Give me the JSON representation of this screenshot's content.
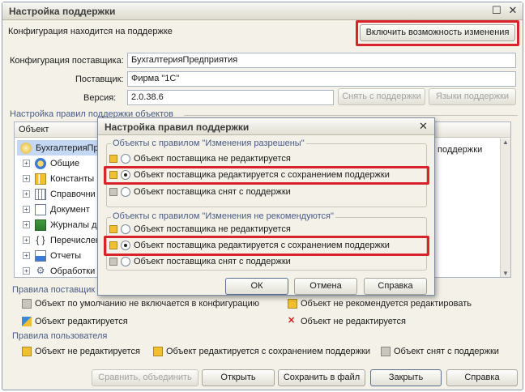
{
  "window": {
    "title": "Настройка поддержки"
  },
  "status": {
    "text": "Конфигурация находится на поддержке",
    "enable_button": "Включить возможность изменения"
  },
  "fields": {
    "config_label": "Конфигурация поставщика:",
    "config_value": "БухгалтерияПредприятия",
    "vendor_label": "Поставщик:",
    "vendor_value": "Фирма \"1С\"",
    "version_label": "Версия:",
    "version_value": "2.0.38.6",
    "remove_support_button": "Снять с поддержки",
    "support_languages_button": "Языки поддержки"
  },
  "objects_group": {
    "title": "Настройка правил поддержки объектов",
    "column": "Объект",
    "right_col_text": "поддержки"
  },
  "tree": [
    {
      "label": "БухгалтерияПр",
      "icon": "config-icon"
    },
    {
      "label": "Общие",
      "icon": "common-icon"
    },
    {
      "label": "Константы",
      "icon": "constants-icon"
    },
    {
      "label": "Справочни",
      "icon": "catalogs-icon"
    },
    {
      "label": "Документ",
      "icon": "documents-icon"
    },
    {
      "label": "Журналы д",
      "icon": "journals-icon"
    },
    {
      "label": "Перечислен",
      "icon": "enums-icon"
    },
    {
      "label": "Отчеты",
      "icon": "reports-icon"
    },
    {
      "label": "Обработки",
      "icon": "processing-icon"
    }
  ],
  "vendor_rules": {
    "title": "Правила поставщик",
    "items": [
      "Объект по умолчанию не включается в конфигурацию",
      "Объект редактируется",
      "Объект не рекомендуется редактировать",
      "Объект не редактируется"
    ]
  },
  "user_rules": {
    "title": "Правила пользователя",
    "items": [
      "Объект не редактируется",
      "Объект редактируется с сохранением поддержки",
      "Объект снят с поддержки"
    ]
  },
  "bottom_buttons": [
    "Сравнить, объединить",
    "Открыть",
    "Сохранить в файл",
    "Закрыть",
    "Справка"
  ],
  "dialog": {
    "title": "Настройка правил поддержки",
    "group1": {
      "title": "Объекты с правилом \"Изменения разрешены\"",
      "options": [
        "Объект поставщика не редактируется",
        "Объект поставщика редактируется с сохранением поддержки",
        "Объект поставщика снят с поддержки"
      ],
      "selected": 1
    },
    "group2": {
      "title": "Объекты с правилом \"Изменения не рекомендуются\"",
      "options": [
        "Объект поставщика не редактируется",
        "Объект поставщика редактируется с сохранением поддержки",
        "Объект поставщика снят с поддержки"
      ],
      "selected": 1
    },
    "ok": "ОК",
    "cancel": "Отмена",
    "help": "Справка"
  }
}
